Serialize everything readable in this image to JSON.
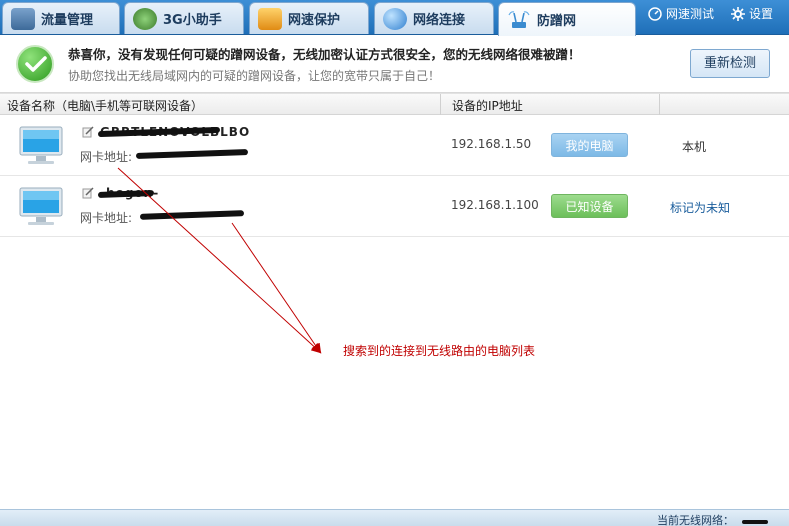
{
  "tabs": [
    {
      "label": "流量管理",
      "icon": "chart-monitor-icon",
      "color": "#5a7fa8"
    },
    {
      "label": "3G小助手",
      "icon": "3g-assistant-icon",
      "color": "#4c8a3a"
    },
    {
      "label": "网速保护",
      "icon": "speed-protect-icon",
      "color": "#e89a1c"
    },
    {
      "label": "网络连接",
      "icon": "globe-icon",
      "color": "#2f7fcf"
    },
    {
      "label": "防蹭网",
      "icon": "wifi-router-icon",
      "color": "#3a8bd0",
      "active": true
    }
  ],
  "toolbar": {
    "speed_test": "网速测试",
    "settings": "设置"
  },
  "banner": {
    "title": "恭喜你，没有发现任何可疑的蹭网设备，无线加密认证方式很安全，您的无线网络很难被蹭！",
    "subtitle": "协助您找出无线局域网内的可疑的蹭网设备，让您的宽带只属于自己！",
    "recheck_label": "重新检测"
  },
  "table": {
    "headers": {
      "device": "设备名称（电脑\\手机等可联网设备）",
      "ip": "设备的IP地址"
    },
    "rows": [
      {
        "name": "GBBTLENOVOLBLBO",
        "mac_label": "网卡地址:",
        "ip": "192.168.1.50",
        "status": "我的电脑",
        "status_color": "#7db9e6",
        "action": "本机"
      },
      {
        "name": "-bogon-",
        "mac_label": "网卡地址:",
        "ip": "192.168.1.100",
        "status": "已知设备",
        "status_color": "#6cbf5a",
        "action": "标记为未知"
      }
    ]
  },
  "annotation": {
    "text": "搜索到的连接到无线路由的电脑列表",
    "color": "#c00000"
  },
  "statusbar": {
    "current_network_label": "当前无线网络："
  }
}
